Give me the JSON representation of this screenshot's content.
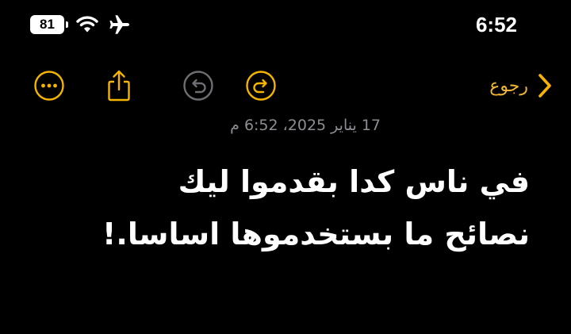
{
  "status_bar": {
    "battery_level": "81",
    "battery_fraction": 0.81,
    "time": "6:52",
    "icons": [
      "wifi-icon",
      "airplane-icon"
    ]
  },
  "toolbar": {
    "back_label": "رجوع",
    "buttons": [
      "more-options-icon",
      "share-icon",
      "undo-icon",
      "redo-icon"
    ],
    "undo_enabled": false,
    "accent_color": "#f4b400"
  },
  "note": {
    "date": "17 يناير 2025، 6:52 م",
    "lines": [
      "في ناس كدا بقدموا ليك",
      "نصائح ما بستخدموها اساسا.!"
    ]
  }
}
